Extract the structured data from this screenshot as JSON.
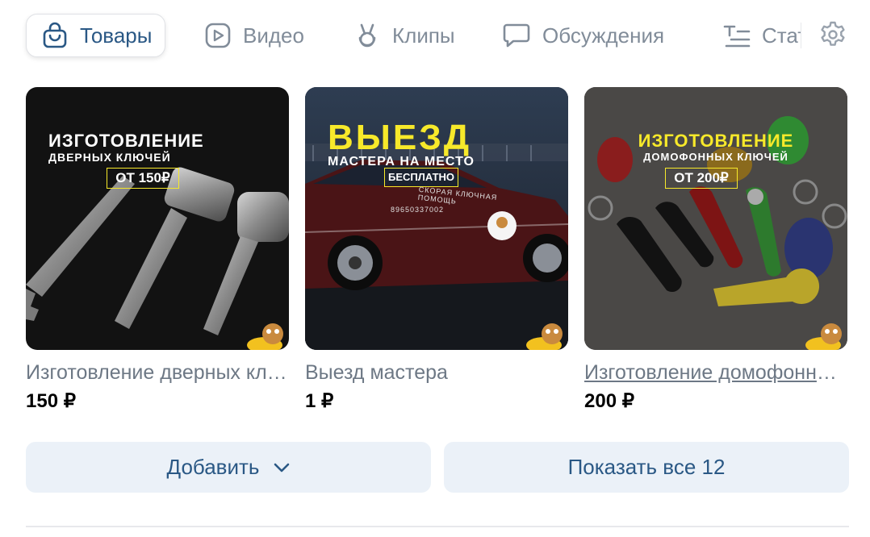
{
  "tabs": [
    {
      "label": "Товары",
      "icon": "shopping-bag-icon",
      "active": true
    },
    {
      "label": "Видео",
      "icon": "video-play-icon",
      "active": false
    },
    {
      "label": "Клипы",
      "icon": "clips-icon",
      "active": false
    },
    {
      "label": "Обсуждения",
      "icon": "discussion-bubble-icon",
      "active": false
    },
    {
      "label": "Статьи",
      "icon": "articles-icon",
      "active": false
    }
  ],
  "settings_icon": "gear-icon",
  "products": [
    {
      "title": "Изготовление дверных ключей",
      "price": "150 ₽",
      "overlay": {
        "line1": "ИЗГОТОВЛЕНИЕ",
        "line2": "ДВЕРНЫХ КЛЮЧЕЙ",
        "boxed": "ОТ 150₽"
      }
    },
    {
      "title": "Выезд мастера",
      "price": "1 ₽",
      "overlay": {
        "line1": "ВЫЕЗД",
        "line2": "МАСТЕРА НА МЕСТО",
        "boxed": "БЕСПЛАТНО",
        "car_text": "СКОРАЯ КЛЮЧНАЯ ПОМОЩЬ",
        "car_phone": "89650337002"
      }
    },
    {
      "title": "Изготовление домофонных ключей",
      "price": "200 ₽",
      "overlay": {
        "line1": "ИЗГОТОВЛЕНИЕ",
        "line2": "ДОМОФОННЫХ КЛЮЧЕЙ",
        "boxed": "ОТ 200₽"
      }
    }
  ],
  "buttons": {
    "add_label": "Добавить",
    "show_all_label": "Показать все 12"
  },
  "colors": {
    "accent": "#2a5885",
    "tab_inactive": "#818c99",
    "button_bg": "#ebf1f8",
    "overlay_yellow": "#f7e92a"
  }
}
